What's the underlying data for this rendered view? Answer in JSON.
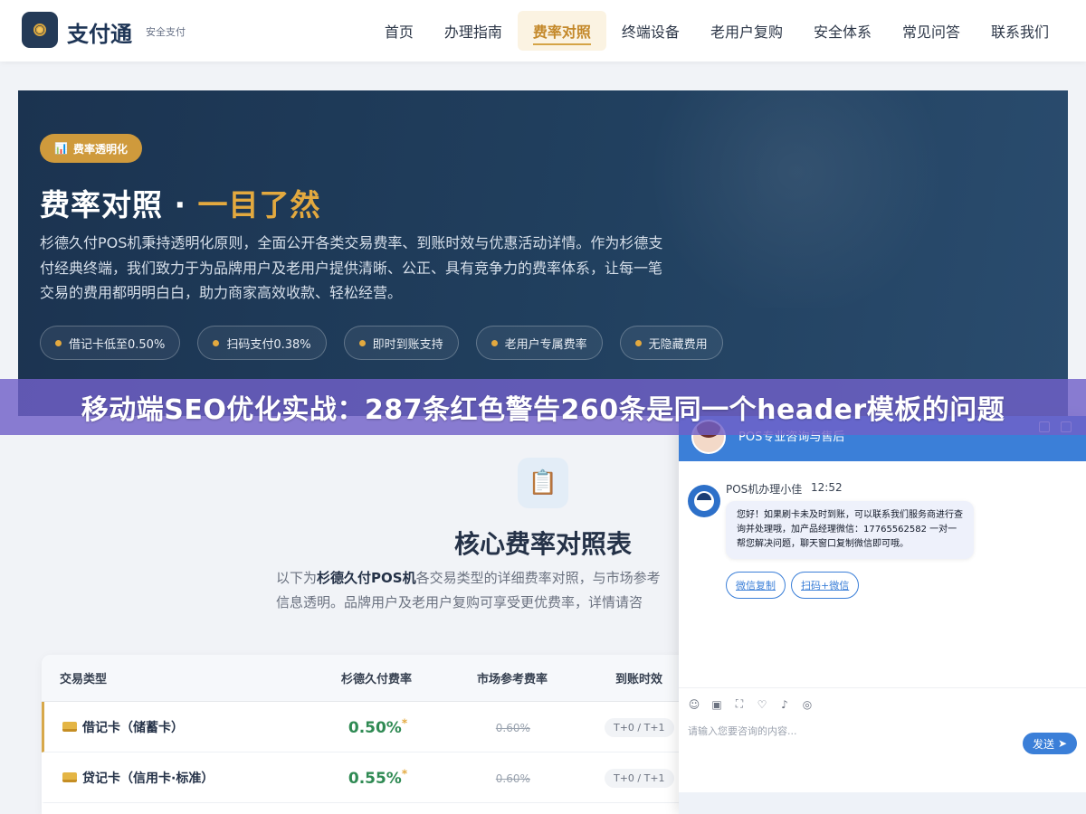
{
  "header": {
    "brand": "支付通",
    "tagline": "安全支付",
    "nav": [
      "首页",
      "办理指南",
      "费率对照",
      "终端设备",
      "老用户复购",
      "安全体系",
      "常见问答",
      "联系我们"
    ],
    "active_nav": "费率对照"
  },
  "hero": {
    "badge": "费率透明化",
    "title_main": "费率对照 · ",
    "title_accent": "一目了然",
    "description": "杉德久付POS机秉持透明化原则，全面公开各类交易费率、到账时效与优惠活动详情。作为杉德支付经典终端，我们致力于为品牌用户及老用户提供清晰、公正、具有竞争力的费率体系，让每一笔交易的费用都明明白白，助力商家高效收款、轻松经营。",
    "pills": [
      "借记卡低至0.50%",
      "扫码支付0.38%",
      "即时到账支持",
      "老用户专属费率",
      "无隐藏费用"
    ]
  },
  "banner": {
    "text": "移动端SEO优化实战：287条红色警告260条是同一个header模板的问题"
  },
  "section": {
    "title": "核心费率对照表",
    "desc_prefix": "以下为",
    "desc_bold": "杉德久付POS机",
    "desc_rest": "各交易类型的详细费率对照，与市场参考",
    "desc_line2": "信息透明。品牌用户及老用户复购可享受更优费率，详情请咨"
  },
  "table": {
    "headers": [
      "交易类型",
      "杉德久付费率",
      "市场参考费率",
      "到账时效"
    ],
    "rows": [
      {
        "type": "借记卡（储蓄卡）",
        "rate": "0.50%",
        "star": "*",
        "market": "0.60%",
        "settle": "T+0 / T+1"
      },
      {
        "type": "贷记卡（信用卡·标准）",
        "rate": "0.55%",
        "star": "*",
        "market": "0.60%",
        "settle": "T+0 / T+1"
      }
    ]
  },
  "chat": {
    "title": "POS专业咨询与售后",
    "agent_name": "POS机办理小佳",
    "time": "12:52",
    "message": "您好！如果刷卡未及时到账，可以联系我们服务商进行查询并处理哦，加产品经理微信：17765562582 一对一帮您解决问题，聊天窗口复制微信即可哦。",
    "buttons": [
      "微信复制",
      "扫码+微信"
    ],
    "input_placeholder": "请输入您要咨询的内容...",
    "send_label": "发送"
  },
  "colors": {
    "brand_navy": "#1e3556",
    "accent_gold": "#d5a446",
    "rate_green": "#2f8a53",
    "chat_blue": "#3b7fd8",
    "banner_purple": "#7060c8"
  }
}
